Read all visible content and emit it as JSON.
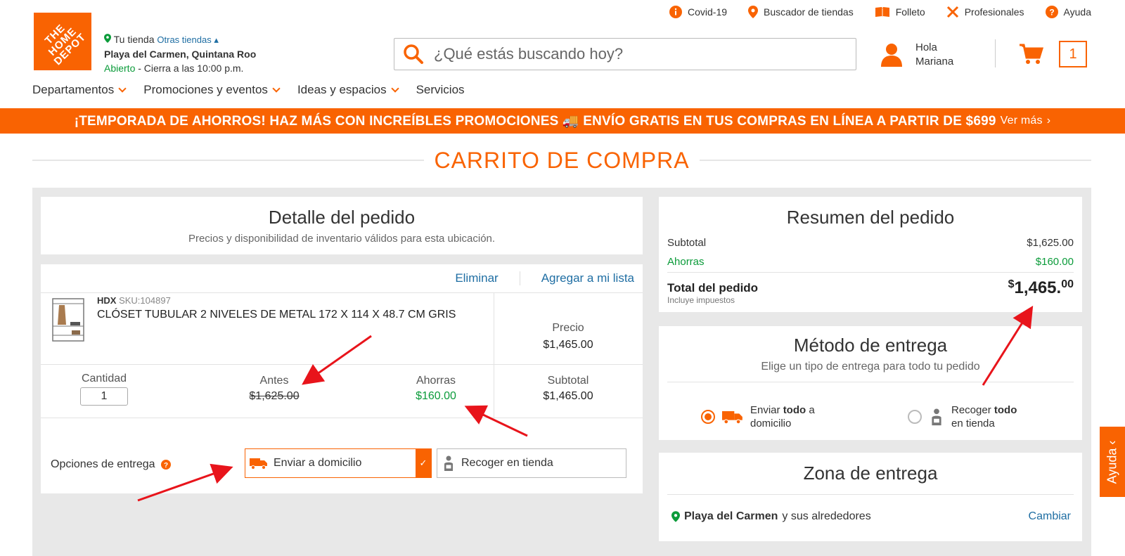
{
  "top_links": [
    {
      "label": "Covid-19",
      "icon": "info-icon"
    },
    {
      "label": "Buscador de tiendas",
      "icon": "location-pin-icon"
    },
    {
      "label": "Folleto",
      "icon": "book-icon"
    },
    {
      "label": "Profesionales",
      "icon": "tools-icon"
    },
    {
      "label": "Ayuda",
      "icon": "help-icon"
    }
  ],
  "logo_text": "THE HOME DEPOT",
  "store": {
    "your_store": "Tu tienda",
    "other_stores": "Otras tiendas",
    "name": "Playa del Carmen, Quintana Roo",
    "open": "Abierto",
    "hours": " - Cierra a las 10:00 p.m."
  },
  "search": {
    "placeholder": "¿Qué estás buscando hoy?"
  },
  "user": {
    "greeting": "Hola",
    "name": "Mariana"
  },
  "cart_count": "1",
  "menu": [
    {
      "label": "Departamentos"
    },
    {
      "label": "Promociones y eventos"
    },
    {
      "label": "Ideas y espacios"
    },
    {
      "label": "Servicios"
    }
  ],
  "banner": {
    "text": "¡TEMPORADA DE AHORROS! HAZ MÁS CON INCREÍBLES PROMOCIONES 🚚 ENVÍO GRATIS EN TUS COMPRAS EN LÍNEA A PARTIR DE $699",
    "link": "Ver más"
  },
  "page_title": "CARRITO DE COMPRA",
  "order_detail": {
    "title": "Detalle del pedido",
    "subtitle": "Precios y disponibilidad de inventario válidos para esta ubicación."
  },
  "item": {
    "remove": "Eliminar",
    "add_list": "Agregar a mi lista",
    "brand": "HDX",
    "sku": "SKU:104897",
    "name": "CLÓSET TUBULAR 2 NIVELES DE METAL 172 X 114 X 48.7 CM GRIS",
    "price_label": "Precio",
    "price": "$1,465.00",
    "qty_label": "Cantidad",
    "qty": "1",
    "before_label": "Antes",
    "before": "$1,625.00",
    "savings_label": "Ahorras",
    "savings": "$160.00",
    "subtotal_label": "Subtotal",
    "subtotal": "$1,465.00",
    "delivery_label": "Opciones de entrega",
    "ship_option": "Enviar a domicilio",
    "pickup_option": "Recoger en tienda"
  },
  "summary": {
    "title": "Resumen del pedido",
    "subtotal_label": "Subtotal",
    "subtotal": "$1,625.00",
    "savings_label": "Ahorras",
    "savings": "$160.00",
    "total_label": "Total del pedido",
    "taxes_note": "Incluye impuestos",
    "total_currency": "$",
    "total_main": "1,465.",
    "total_cents": "00"
  },
  "delivery_method": {
    "title": "Método de entrega",
    "subtitle": "Elige un tipo de entrega para todo tu pedido",
    "option1_a": "Enviar ",
    "option1_b": "todo",
    "option1_c": " a",
    "option1_d": "domicilio",
    "option2_a": "Recoger ",
    "option2_b": "todo",
    "option2_c": "en tienda"
  },
  "zone": {
    "title": "Zona de entrega",
    "city": "Playa del Carmen",
    "rest": " y sus alrededores",
    "change": "Cambiar"
  },
  "help_tab": "Ayuda",
  "colors": {
    "brand": "#f96302",
    "savings": "#0b9b3a",
    "link": "#1f6ea3",
    "arrow": "#e8141b"
  }
}
